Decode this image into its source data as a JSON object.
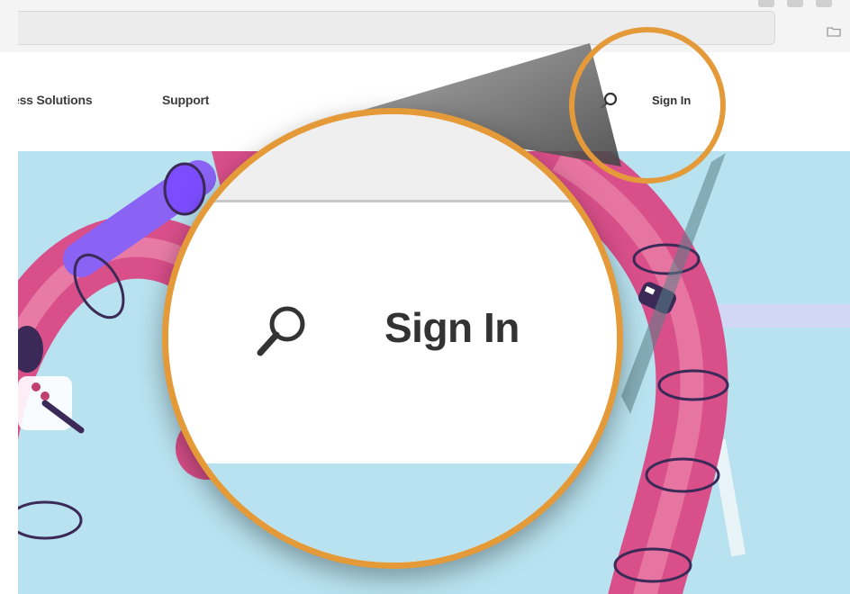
{
  "nav": {
    "links": [
      "ess Solutions",
      "Support"
    ],
    "signin_label": "Sign In"
  },
  "magnifier": {
    "signin_label": "Sign In"
  },
  "icons": {
    "search": "search-icon",
    "folder": "folder-icon"
  },
  "colors": {
    "ring": "#e59a3a",
    "hero_background": "#b8e2ef",
    "tube_pink": "#d94f8a",
    "tube_light": "#ee8fb0",
    "tube_ring": "#3b2a57",
    "purple": "#7c4dff"
  }
}
